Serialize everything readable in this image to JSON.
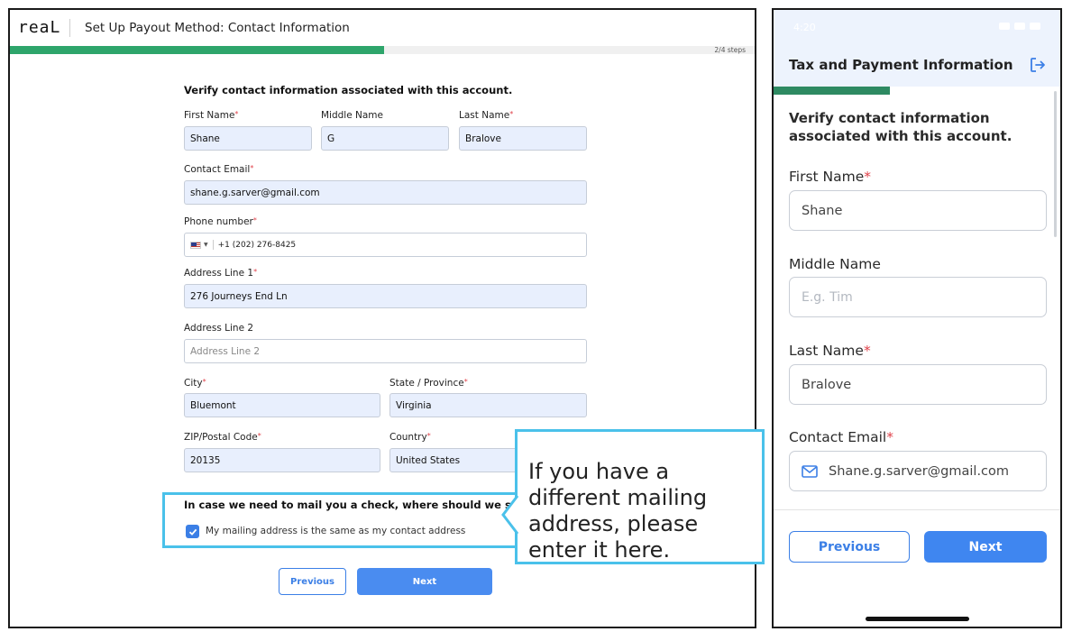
{
  "desktop": {
    "logo": "reaL",
    "title": "Set Up Payout Method: Contact Information",
    "steps_label": "2/4 steps",
    "progress_fraction": 0.5,
    "heading": "Verify contact information associated with this account.",
    "fields": {
      "first_name": {
        "label": "First Name",
        "value": "Shane"
      },
      "middle_name": {
        "label": "Middle Name",
        "value": "G"
      },
      "last_name": {
        "label": "Last Name",
        "value": "Bralove"
      },
      "email": {
        "label": "Contact Email",
        "value": "shane.g.sarver@gmail.com"
      },
      "phone": {
        "label": "Phone number",
        "value": "+1 (202) 276-8425"
      },
      "address1": {
        "label": "Address Line 1",
        "value": "276 Journeys End Ln"
      },
      "address2": {
        "label": "Address Line 2",
        "placeholder": "Address Line 2"
      },
      "city": {
        "label": "City",
        "value": "Bluemont"
      },
      "state": {
        "label": "State / Province",
        "value": "Virginia"
      },
      "zip": {
        "label": "ZIP/Postal Code",
        "value": "20135"
      },
      "country": {
        "label": "Country",
        "value": "United States"
      }
    },
    "mailing_question": "In case we need to mail you a check, where should we send it?",
    "mailing_same_label": "My mailing address is the same as my contact address",
    "mailing_same_checked": true,
    "previous_label": "Previous",
    "next_label": "Next"
  },
  "callout": {
    "text": "If you have a different mailing address, please enter it here."
  },
  "mobile": {
    "status_time": "4:20",
    "title": "Tax and Payment Information",
    "progress_fraction": 0.4,
    "heading": "Verify contact information associated with this account.",
    "first_name": {
      "label": "First Name",
      "value": "Shane"
    },
    "middle_name": {
      "label": "Middle Name",
      "placeholder": "E.g. Tim"
    },
    "last_name": {
      "label": "Last Name",
      "value": "Bralove"
    },
    "email": {
      "label": "Contact Email",
      "value": "Shane.g.sarver@gmail.com"
    },
    "previous_label": "Previous",
    "next_label": "Next"
  },
  "colors": {
    "accent": "#3b7fe6",
    "progress_green": "#2ea56b",
    "callout_border": "#4ac1ea",
    "required_red": "#e0424a"
  },
  "icons": [
    "us-flag-icon",
    "checkbox-checked-icon",
    "logout-icon",
    "mail-icon"
  ]
}
